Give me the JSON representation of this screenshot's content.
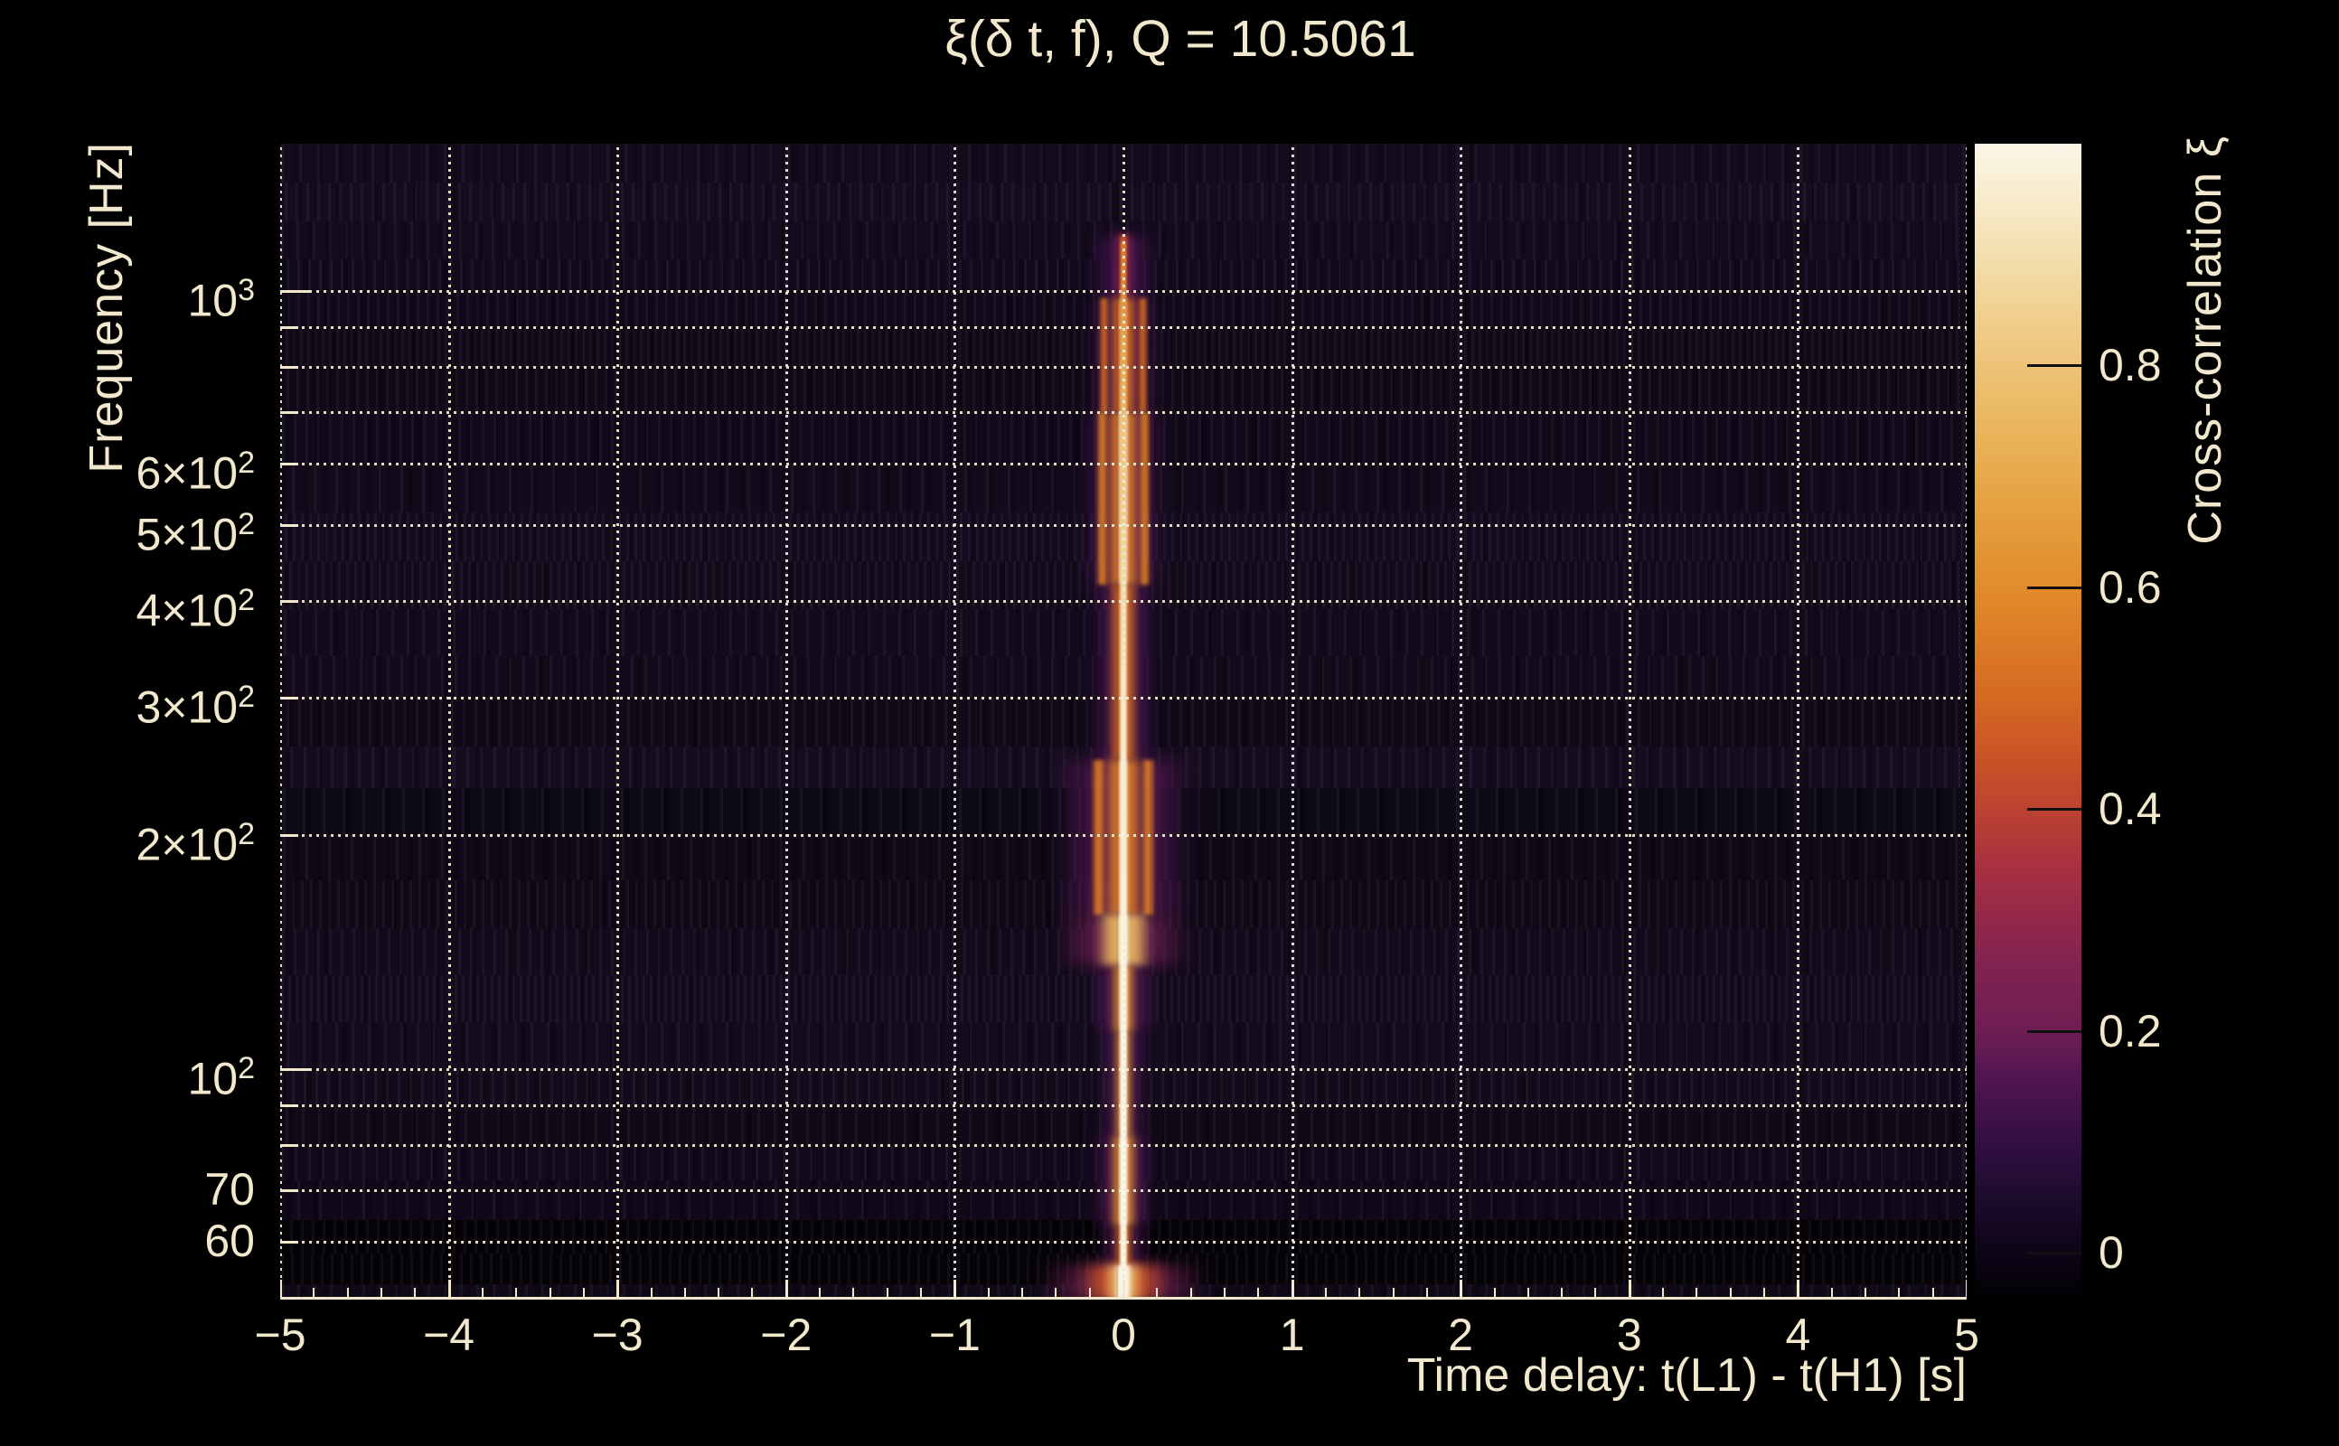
{
  "title": "ξ(δ t, f), Q = 10.5061",
  "x_axis": {
    "label": "Time delay: t(L1) - t(H1) [s]",
    "min": -5,
    "max": 5,
    "major_ticks": [
      -5,
      -4,
      -3,
      -2,
      -1,
      0,
      1,
      2,
      3,
      4,
      5
    ],
    "major_tick_labels": [
      "−5",
      "−4",
      "−3",
      "−2",
      "−1",
      "0",
      "1",
      "2",
      "3",
      "4",
      "5"
    ],
    "minor_step": 0.2
  },
  "y_axis": {
    "label": "Frequency [Hz]",
    "scale": "log",
    "min": 50.6,
    "max": 1547,
    "ticks": [
      {
        "f": 1000,
        "text": "10",
        "sup": "3"
      },
      {
        "f": 600,
        "text": "6×10",
        "sup": "2"
      },
      {
        "f": 500,
        "text": "5×10",
        "sup": "2"
      },
      {
        "f": 400,
        "text": "4×10",
        "sup": "2"
      },
      {
        "f": 300,
        "text": "3×10",
        "sup": "2"
      },
      {
        "f": 200,
        "text": "2×10",
        "sup": "2"
      },
      {
        "f": 100,
        "text": "10",
        "sup": "2"
      },
      {
        "f": 70,
        "text": "70",
        "sup": ""
      },
      {
        "f": 60,
        "text": "60",
        "sup": ""
      }
    ],
    "unlabeled_gridlines": [
      900,
      800,
      700,
      90,
      80
    ]
  },
  "colorbar": {
    "label": "Cross-correlation ξ",
    "min": -0.04,
    "max": 1.0,
    "ticks": [
      0,
      0.2,
      0.4,
      0.6,
      0.8
    ],
    "tick_labels": [
      "0",
      "0.2",
      "0.4",
      "0.6",
      "0.8"
    ]
  },
  "colors": {
    "figure_background": "#000000",
    "text": "#f1e8cd",
    "gridline": "#f4ebd6",
    "plot_background": "#140a1e",
    "colormap_stops": [
      [
        -0.04,
        "#020103"
      ],
      [
        0.0,
        "#0d0517"
      ],
      [
        0.05,
        "#1d0c2d"
      ],
      [
        0.1,
        "#330f43"
      ],
      [
        0.15,
        "#4c1450"
      ],
      [
        0.2,
        "#6e1e53"
      ],
      [
        0.25,
        "#7e2251"
      ],
      [
        0.3,
        "#93284a"
      ],
      [
        0.35,
        "#a93140"
      ],
      [
        0.4,
        "#bc4330"
      ],
      [
        0.45,
        "#cb5526"
      ],
      [
        0.5,
        "#d56a22"
      ],
      [
        0.55,
        "#dc7b26"
      ],
      [
        0.6,
        "#e18c2b"
      ],
      [
        0.65,
        "#e49a39"
      ],
      [
        0.7,
        "#e7a94b"
      ],
      [
        0.75,
        "#eab75f"
      ],
      [
        0.8,
        "#edc378"
      ],
      [
        0.85,
        "#f0d191"
      ],
      [
        0.9,
        "#f3dfae"
      ],
      [
        0.95,
        "#f7ebcb"
      ],
      [
        1.0,
        "#fbf6e8"
      ]
    ]
  },
  "chart_data": {
    "type": "heatmap",
    "title": "ξ(δ t, f), Q = 10.5061",
    "xlabel": "Time delay: t(L1) - t(H1) [s]",
    "ylabel": "Frequency [Hz]",
    "zlabel": "Cross-correlation ξ",
    "xlim": [
      -5,
      5
    ],
    "ylim_hz": [
      50.6,
      1547
    ],
    "y_scale": "log",
    "zlim": [
      -0.04,
      1.0
    ],
    "grid": "dotted",
    "background_xi": 0.05,
    "description": "Cross-correlation of L1 vs H1 as a function of time delay and frequency; a narrow bright ridge of high correlation sits at delay = 0 s spanning ~55-1100 Hz, widest and brightest near 50-55 Hz, ~150 Hz and 100-450 Hz; elsewhere near-zero dark purple background.",
    "features": [
      {
        "f_hi": 1180,
        "f_lo": 980,
        "core_xi": 0.45,
        "core_w_s": 0.02,
        "glow_xi": 0.3,
        "glow_w_s": 0.06,
        "halo_xi": 0.12,
        "halo_w_s": 0.18
      },
      {
        "f_hi": 980,
        "f_lo": 700,
        "core_xi": 0.75,
        "core_w_s": 0.025,
        "glow_xi": 0.5,
        "glow_w_s": 0.09,
        "halo_xi": 0.14,
        "halo_w_s": 0.22,
        "streaks": [
          {
            "dx_s": -0.115,
            "w_s": 0.03,
            "xi": 0.5
          },
          {
            "dx_s": 0.115,
            "w_s": 0.03,
            "xi": 0.5
          }
        ]
      },
      {
        "f_hi": 700,
        "f_lo": 420,
        "core_xi": 0.95,
        "core_w_s": 0.03,
        "glow_xi": 0.55,
        "glow_w_s": 0.11,
        "halo_xi": 0.15,
        "halo_w_s": 0.25,
        "streaks": [
          {
            "dx_s": -0.125,
            "w_s": 0.035,
            "xi": 0.55
          },
          {
            "dx_s": 0.125,
            "w_s": 0.035,
            "xi": 0.55
          }
        ]
      },
      {
        "f_hi": 420,
        "f_lo": 250,
        "core_xi": 0.85,
        "core_w_s": 0.025,
        "glow_xi": 0.5,
        "glow_w_s": 0.09,
        "halo_xi": 0.13,
        "halo_w_s": 0.2
      },
      {
        "f_hi": 250,
        "f_lo": 158,
        "core_xi": 0.95,
        "core_w_s": 0.03,
        "glow_xi": 0.55,
        "glow_w_s": 0.13,
        "halo_xi": 0.16,
        "halo_w_s": 0.42,
        "streaks": [
          {
            "dx_s": -0.145,
            "w_s": 0.04,
            "xi": 0.55
          },
          {
            "dx_s": 0.145,
            "w_s": 0.04,
            "xi": 0.55
          }
        ]
      },
      {
        "f_hi": 158,
        "f_lo": 136,
        "core_xi": 1.0,
        "core_w_s": 0.04,
        "glow_xi": 0.75,
        "glow_w_s": 0.17,
        "halo_xi": 0.2,
        "halo_w_s": 0.4
      },
      {
        "f_hi": 136,
        "f_lo": 112,
        "core_xi": 0.97,
        "core_w_s": 0.03,
        "glow_xi": 0.6,
        "glow_w_s": 0.08,
        "halo_xi": 0.15,
        "halo_w_s": 0.2
      },
      {
        "f_hi": 112,
        "f_lo": 82,
        "core_xi": 0.98,
        "core_w_s": 0.025,
        "glow_xi": 0.62,
        "glow_w_s": 0.06,
        "halo_xi": 0.13,
        "halo_w_s": 0.13
      },
      {
        "f_hi": 82,
        "f_lo": 63,
        "core_xi": 0.98,
        "core_w_s": 0.03,
        "glow_xi": 0.6,
        "glow_w_s": 0.085,
        "halo_xi": 0.15,
        "halo_w_s": 0.18
      },
      {
        "f_hi": 63,
        "f_lo": 56,
        "core_xi": 0.85,
        "core_w_s": 0.025,
        "glow_xi": 0.5,
        "glow_w_s": 0.06,
        "halo_xi": 0.12,
        "halo_w_s": 0.14
      },
      {
        "f_hi": 56,
        "f_lo": 50.6,
        "core_xi": 1.0,
        "core_w_s": 0.055,
        "glow_xi": 0.78,
        "glow_w_s": 0.12,
        "band_xi": 0.45,
        "band_w_s": 0.27,
        "halo_xi": 0.22,
        "halo_w_s": 0.5
      }
    ]
  }
}
